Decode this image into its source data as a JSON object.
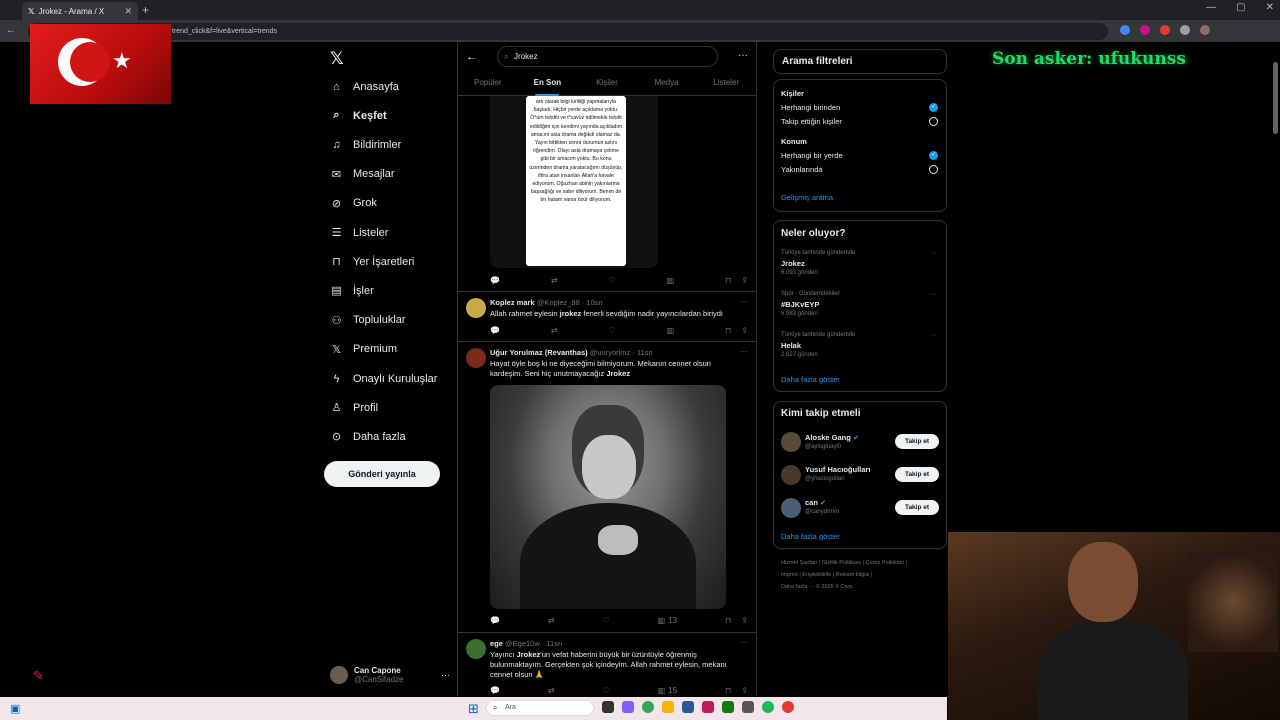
{
  "browser": {
    "tab_title": "Jrokez - Arama / X",
    "url_fragment": "trend_click&f=live&vertical=trends"
  },
  "nav": {
    "items": [
      {
        "label": "Anasayfa",
        "icon": "home-icon"
      },
      {
        "label": "Keşfet",
        "icon": "search-icon"
      },
      {
        "label": "Bildirimler",
        "icon": "bell-icon"
      },
      {
        "label": "Mesajlar",
        "icon": "mail-icon"
      },
      {
        "label": "Grok",
        "icon": "grok-icon"
      },
      {
        "label": "Listeler",
        "icon": "list-icon"
      },
      {
        "label": "Yer İşaretleri",
        "icon": "bookmark-icon"
      },
      {
        "label": "İşler",
        "icon": "briefcase-icon"
      },
      {
        "label": "Topluluklar",
        "icon": "people-icon"
      },
      {
        "label": "Premium",
        "icon": "x-icon"
      },
      {
        "label": "Onaylı Kuruluşlar",
        "icon": "bolt-icon"
      },
      {
        "label": "Profil",
        "icon": "user-icon"
      },
      {
        "label": "Daha fazla",
        "icon": "more-circle-icon"
      }
    ],
    "post_button": "Gönderi yayınla",
    "account": {
      "name": "Can Capone",
      "handle": "@CanSifadze"
    }
  },
  "search": {
    "query": "Jrokez",
    "tabs": [
      "Popüler",
      "En Son",
      "Kişiler",
      "Medya",
      "Listeler"
    ]
  },
  "tweets": {
    "t1": {
      "image_text": "artı olarak bilgi kirliliği yapmalarıyla başladı. Hiçbir yerde açıklama yoktu. Ö*üm tehditi ve t*cavüz edilmekle tehdit edildiğim için kendimi yayında açıkladım amacım asla drama değikdi olamaz da. Yayın bittikten sonra durumun aslını öğrendim. Olayı asla dramaya çekme gibi bir amacım yoktu. Bu konu üzerinden drama yaratacağımı düşünüp, iftira atan insanları Allah'a havale ediyorum. Oğuzhan abinin yakınlarına başsağlığı ve sabır diliyorum. Benim de bir hatam varsa özür diliyorum."
    },
    "t2": {
      "name": "Koplez mark",
      "handle": "@Koplez_98 · 10sn",
      "text_before": "Allah rahmet eylesin ",
      "text_bold": "jrokez",
      "text_after": " fenerli sevdiğim nadir yayıncılardan biriydi"
    },
    "t3": {
      "name": "Uğur Yorulmaz (Revanthas)",
      "handle": "@uuryorlmz · 11sn",
      "text_before": "Hayat öyle boş ki ne diyeceğimi bilmiyorum. Mekanın cennet olsun kardeşim. Seni hiç unutmayacağız ",
      "text_bold": "Jrokez",
      "views": "13"
    },
    "t4": {
      "name": "ege",
      "handle": "@Ege10w · 11sn",
      "text_before": "Yayıncı ",
      "text_bold": "Jrokez",
      "text_after": "'un vefat haberini büyük bir üzüntüyle öğrenmiş bulunmaktayım. Gerçekten şok içindeyim. Allah rahmet eylesin, mekanı cennet olsun 🙏",
      "views": "15"
    }
  },
  "filters": {
    "title": "Arama filtreleri",
    "people_label": "Kişiler",
    "people_opt1": "Herhangi birinden",
    "people_opt2": "Takip ettiğin kişiler",
    "location_label": "Konum",
    "location_opt1": "Herhangi bir yerde",
    "location_opt2": "Yakınlarında",
    "advanced": "Gelişmiş arama"
  },
  "trends": {
    "title": "Neler oluyor?",
    "items": [
      {
        "context": "Türkiye tarihinde gündemde",
        "name": "Jrokez",
        "count": "6.093 gönderi"
      },
      {
        "context": "Spor · Gündemdekiler",
        "name": "#BJKvEYP",
        "count": "6.983 gönderi"
      },
      {
        "context": "Türkiye tarihinde gündemde",
        "name": "Helak",
        "count": "2.627 gönderi"
      }
    ],
    "show_more": "Daha fazla göster"
  },
  "who_to_follow": {
    "title": "Kimi takip etmeli",
    "items": [
      {
        "name": "Aloske Gang",
        "handle": "@aylogluayl0",
        "button": "Takip et"
      },
      {
        "name": "Yusuf Hacıoğulları",
        "handle": "@yhaciogullari",
        "button": "Takip et"
      },
      {
        "name": "can",
        "handle": "@canydrmm",
        "button": "Takip et"
      }
    ],
    "show_more": "Daha fazla göster"
  },
  "footer": {
    "line1": "Hizmet Şartları  |  Gizlilik Politikası  |  Çerez Politikası  |",
    "line2": "Imprint  |  Erişilebilirlik  |  Reklam bilgisi  |",
    "line3": "Daha fazla ···   © 2025 X Corp."
  },
  "overlay": {
    "text": "Son asker: ufukunss"
  },
  "taskbar": {
    "search": "Ara"
  },
  "colors": {
    "accent": "#1d9bf0",
    "overlay_green": "#19e06a",
    "background": "#000000"
  }
}
